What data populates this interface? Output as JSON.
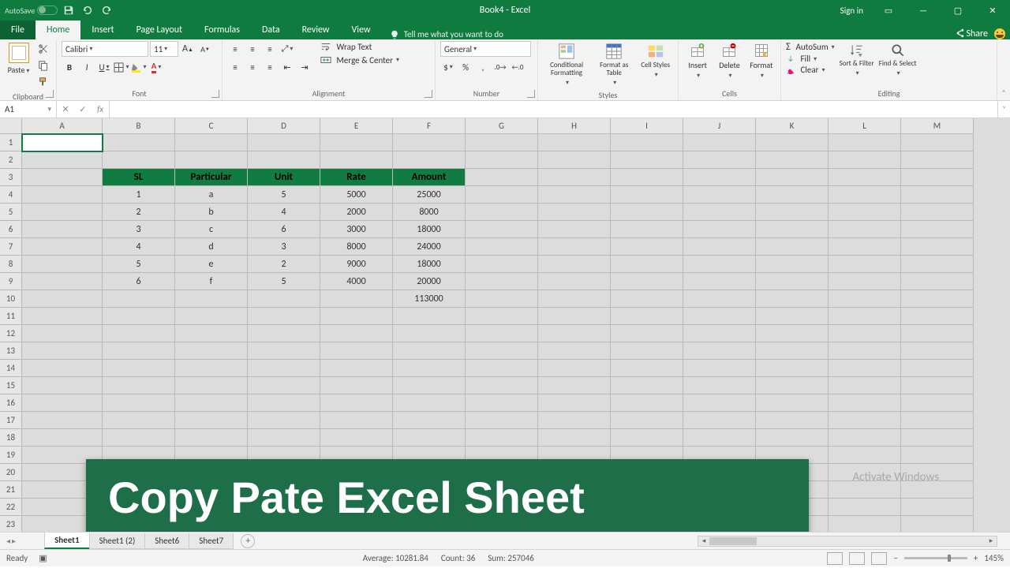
{
  "titlebar": {
    "autosave_label": "AutoSave",
    "title": "Book4 - Excel",
    "signin": "Sign in"
  },
  "tabs": {
    "file": "File",
    "items": [
      "Home",
      "Insert",
      "Page Layout",
      "Formulas",
      "Data",
      "Review",
      "View"
    ],
    "active": "Home",
    "tellme": "Tell me what you want to do",
    "share": "Share"
  },
  "ribbon": {
    "clipboard": {
      "paste": "Paste",
      "label": "Clipboard"
    },
    "font": {
      "family": "Calibri",
      "size": "11",
      "bold": "B",
      "italic": "I",
      "underline": "U",
      "label": "Font"
    },
    "alignment": {
      "wrap": "Wrap Text",
      "merge": "Merge & Center",
      "label": "Alignment"
    },
    "number": {
      "format": "General",
      "label": "Number"
    },
    "styles": {
      "cond": "Conditional Formatting",
      "table": "Format as Table",
      "cell": "Cell Styles",
      "label": "Styles"
    },
    "cells": {
      "insert": "Insert",
      "delete": "Delete",
      "format": "Format",
      "label": "Cells"
    },
    "editing": {
      "autosum": "AutoSum",
      "fill": "Fill",
      "clear": "Clear",
      "sort": "Sort & Filter",
      "find": "Find & Select",
      "label": "Editing"
    }
  },
  "namebox": "A1",
  "columns": [
    "A",
    "B",
    "C",
    "D",
    "E",
    "F",
    "G",
    "H",
    "I",
    "J",
    "K",
    "L",
    "M"
  ],
  "rows_visible": 23,
  "table": {
    "headers": [
      "SL",
      "Particular",
      "Unit",
      "Rate",
      "Amount"
    ],
    "rows": [
      {
        "sl": "1",
        "particular": "a",
        "unit": "5",
        "rate": "5000",
        "amount": "25000"
      },
      {
        "sl": "2",
        "particular": "b",
        "unit": "4",
        "rate": "2000",
        "amount": "8000"
      },
      {
        "sl": "3",
        "particular": "c",
        "unit": "6",
        "rate": "3000",
        "amount": "18000"
      },
      {
        "sl": "4",
        "particular": "d",
        "unit": "3",
        "rate": "8000",
        "amount": "24000"
      },
      {
        "sl": "5",
        "particular": "e",
        "unit": "2",
        "rate": "9000",
        "amount": "18000"
      },
      {
        "sl": "6",
        "particular": "f",
        "unit": "5",
        "rate": "4000",
        "amount": "20000"
      }
    ],
    "total": "113000"
  },
  "banner_text": "Copy Pate Excel Sheet",
  "sheets": {
    "tabs": [
      "Sheet1",
      "Sheet1 (2)",
      "Sheet6",
      "Sheet7"
    ],
    "active": "Sheet1"
  },
  "status": {
    "ready": "Ready",
    "average_label": "Average:",
    "average": "10281.84",
    "count_label": "Count:",
    "count": "36",
    "sum_label": "Sum:",
    "sum": "257046",
    "zoom": "145%"
  },
  "watermark": "Activate Windows"
}
